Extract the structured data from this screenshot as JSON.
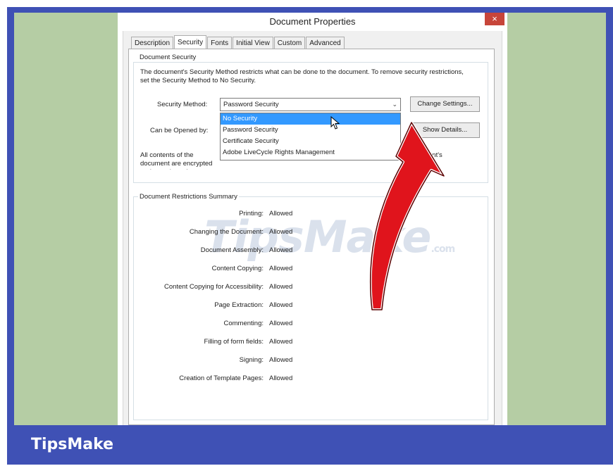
{
  "dialog": {
    "title": "Document Properties",
    "close_label": "×",
    "tabs": [
      {
        "label": "Description"
      },
      {
        "label": "Security"
      },
      {
        "label": "Fonts"
      },
      {
        "label": "Initial View"
      },
      {
        "label": "Custom"
      },
      {
        "label": "Advanced"
      }
    ],
    "active_tab": "Security"
  },
  "security": {
    "group_title": "Document Security",
    "description": "The document's Security Method restricts what can be done to the document. To remove security restrictions, set the Security Method to No Security.",
    "method_label": "Security Method:",
    "method_value": "Password Security",
    "change_settings_label": "Change Settings...",
    "opened_by_label": "Can be Opened by:",
    "show_details_label": "Show Details...",
    "dropdown_options": [
      {
        "label": "No Security",
        "selected": true
      },
      {
        "label": "Password Security",
        "selected": false
      },
      {
        "label": "Certificate Security",
        "selected": false
      },
      {
        "label": "Adobe LiveCycle Rights Management",
        "selected": false
      }
    ],
    "metadata_text_left": "All contents of the document are encrypted and search engines cannot access the document's metadata.",
    "metadata_text_right": "ent's"
  },
  "restrictions": {
    "group_title": "Document Restrictions Summary",
    "rows": [
      {
        "label": "Printing:",
        "value": "Allowed"
      },
      {
        "label": "Changing the Document:",
        "value": "Allowed"
      },
      {
        "label": "Document Assembly:",
        "value": "Allowed"
      },
      {
        "label": "Content Copying:",
        "value": "Allowed"
      },
      {
        "label": "Content Copying for Accessibility:",
        "value": "Allowed"
      },
      {
        "label": "Page Extraction:",
        "value": "Allowed"
      },
      {
        "label": "Commenting:",
        "value": "Allowed"
      },
      {
        "label": "Filling of form fields:",
        "value": "Allowed"
      },
      {
        "label": "Signing:",
        "value": "Allowed"
      },
      {
        "label": "Creation of Template Pages:",
        "value": "Allowed"
      }
    ]
  },
  "watermark": {
    "text": "TipsMake",
    "suffix": ".com"
  },
  "brand": {
    "name": "TipsMake"
  },
  "colors": {
    "frame_blue": "#3f51b5",
    "side_green": "#b5cda4",
    "selection_blue": "#3399ff",
    "arrow_red": "#e0141c",
    "close_red": "#c7453a"
  },
  "icons": {
    "close": "close-icon",
    "dropdown": "chevron-down-icon",
    "pointer": "mouse-cursor-icon",
    "annotation": "red-arrow-icon"
  }
}
